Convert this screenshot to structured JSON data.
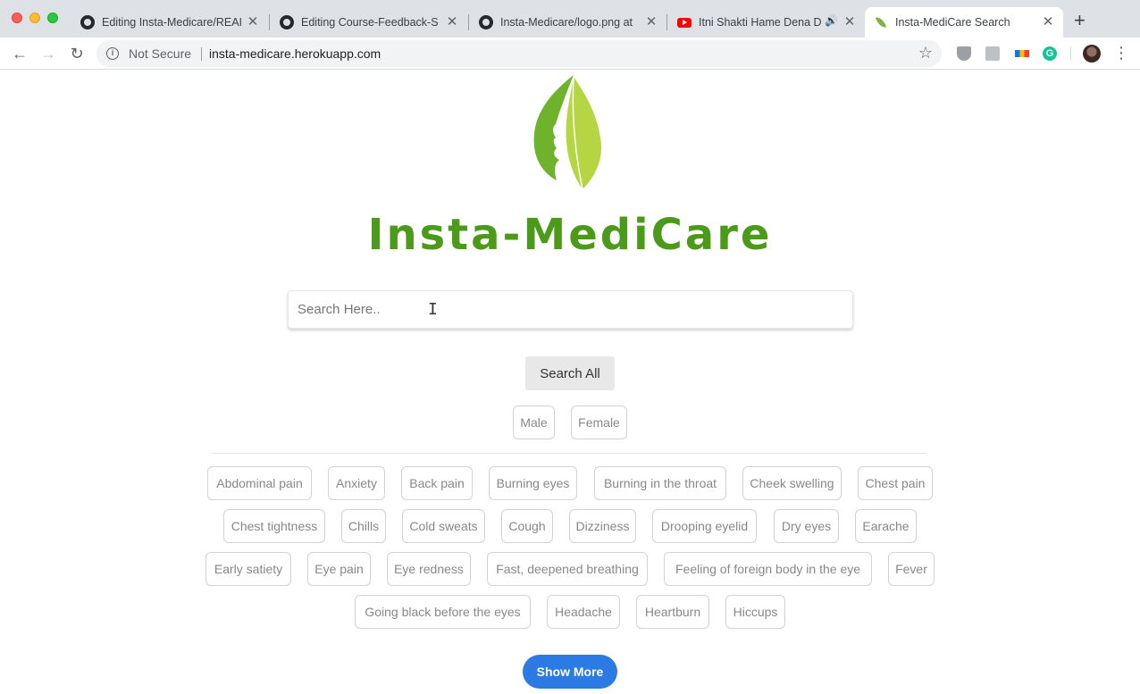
{
  "browser": {
    "tabs": [
      {
        "title": "Editing Insta-Medicare/REAI",
        "favicon": "github-icon"
      },
      {
        "title": "Editing Course-Feedback-S",
        "favicon": "github-icon"
      },
      {
        "title": "Insta-Medicare/logo.png at",
        "favicon": "github-icon"
      },
      {
        "title": "Itni Shakti Hame Dena D",
        "favicon": "youtube-icon"
      },
      {
        "title": "Insta-MediCare Search",
        "favicon": "leaf-icon"
      }
    ],
    "security_label": "Not Secure",
    "url": "insta-medicare.herokuapp.com"
  },
  "page": {
    "logo_text": "Insta-MediCare",
    "search_placeholder": "Search Here..",
    "search_value": "",
    "search_all_label": "Search All",
    "gender": [
      "Male",
      "Female"
    ],
    "symptoms_rows": [
      [
        "Abdominal pain",
        "Anxiety",
        "Back pain",
        "Burning eyes",
        "Burning in the throat",
        "Cheek swelling",
        "Chest pain"
      ],
      [
        "Chest tightness",
        "Chills",
        "Cold sweats",
        "Cough",
        "Dizziness",
        "Drooping eyelid",
        "Dry eyes",
        "Earache"
      ],
      [
        "Early satiety",
        "Eye pain",
        "Eye redness",
        "Fast, deepened breathing",
        "Feeling of foreign body in the eye",
        "Fever"
      ],
      [
        "Going black before the eyes",
        "Headache",
        "Heartburn",
        "Hiccups"
      ]
    ],
    "show_more_label": "Show More"
  },
  "colors": {
    "brand_green": "#4c9a1a",
    "leaf_light": "#b5d542",
    "button_blue": "#2c7be5"
  }
}
